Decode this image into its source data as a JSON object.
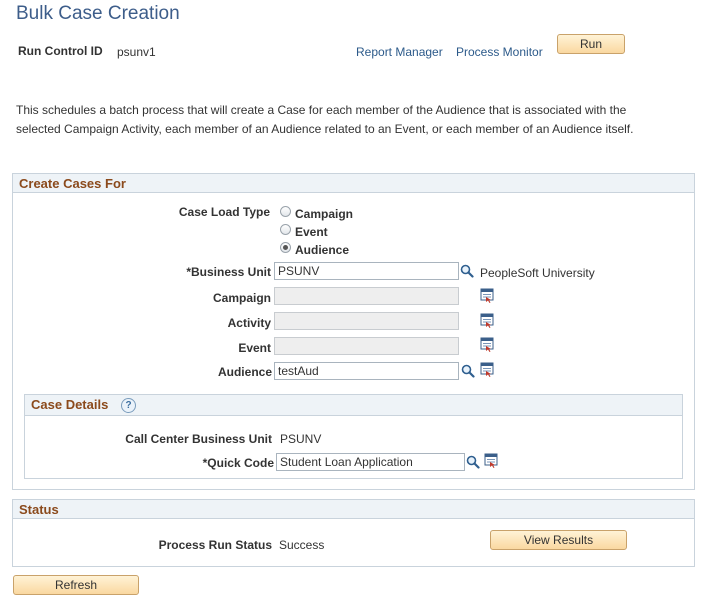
{
  "page": {
    "title": "Bulk Case Creation",
    "run_control_label": "Run Control ID",
    "run_control_value": "psunv1",
    "report_manager_link": "Report Manager",
    "process_monitor_link": "Process Monitor",
    "run_button": "Run",
    "description": "This schedules a batch process that will create a Case for each member of the Audience that is associated with the selected Campaign Activity, each member of an Audience related to an Event, or each member of an Audience itself."
  },
  "create_cases": {
    "header": "Create Cases For",
    "case_load_type_label": "Case Load Type",
    "options": [
      {
        "label": "Campaign",
        "selected": false
      },
      {
        "label": "Event",
        "selected": false
      },
      {
        "label": "Audience",
        "selected": true
      }
    ],
    "business_unit_label": "*Business Unit",
    "business_unit_value": "PSUNV",
    "business_unit_desc": "PeopleSoft University",
    "campaign_label": "Campaign",
    "campaign_value": "",
    "activity_label": "Activity",
    "activity_value": "",
    "event_label": "Event",
    "event_value": "",
    "audience_label": "Audience",
    "audience_value": "testAud"
  },
  "case_details": {
    "header": "Case Details",
    "help_glyph": "?",
    "cc_bu_label": "Call Center Business Unit",
    "cc_bu_value": "PSUNV",
    "quick_code_label": "*Quick Code",
    "quick_code_value": "Student Loan Application"
  },
  "status": {
    "header": "Status",
    "run_status_label": "Process Run Status",
    "run_status_value": "Success",
    "view_results_button": "View Results"
  },
  "footer": {
    "refresh_button": "Refresh"
  },
  "colors": {
    "title": "#3d5d8a",
    "group_header_text": "#8b4a1c",
    "group_header_bg": "#eef3f7",
    "button_bg": "#fad8a0",
    "link": "#2c5a8a"
  },
  "icons": {
    "lookup": "magnifier-icon",
    "prompt_list": "prompt-list-icon",
    "help": "help-icon"
  }
}
